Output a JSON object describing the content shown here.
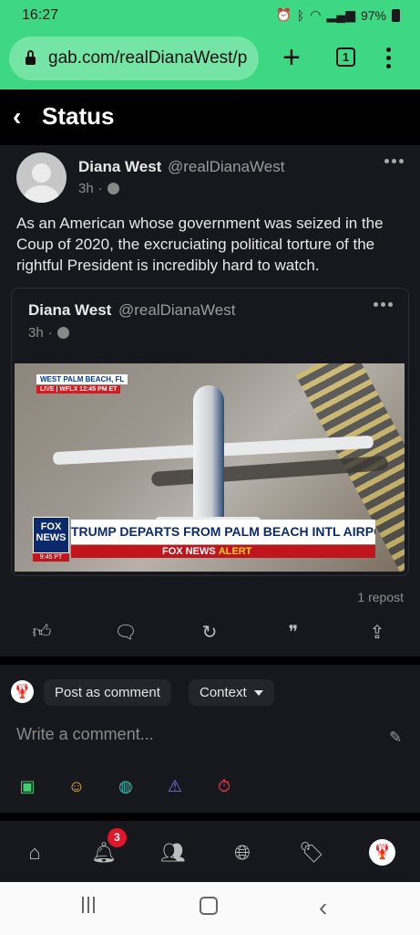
{
  "status_bar": {
    "time": "16:27",
    "battery": "97%"
  },
  "browser": {
    "url": "gab.com/realDianaWest/p",
    "tab_count": "1"
  },
  "header": {
    "back_icon": "‹",
    "title": "Status"
  },
  "post": {
    "author_name": "Diana West",
    "author_handle": "@realDianaWest",
    "age": "3h",
    "separator": "·",
    "text": "As an American whose government was seized in the Coup of 2020, the excruciating political torture of the rightful President is incredibly hard to watch.",
    "quote": {
      "author_name": "Diana West",
      "author_handle": "@realDianaWest",
      "age": "3h",
      "separator": "·",
      "media": {
        "location_tag": "WEST PALM BEACH, FL",
        "live_tag": "LIVE | WFLX 12:45 PM ET",
        "channel_logo": "FOX NEWS",
        "clock": "9:45 PT",
        "headline": "TRUMP DEPARTS FROM PALM BEACH INTL AIRPORT",
        "alert_brand": "FOX NEWS",
        "alert_word": "ALERT"
      }
    },
    "repost_count": "1 repost"
  },
  "composer": {
    "post_as_comment": "Post as comment",
    "context": "Context",
    "placeholder": "Write a comment..."
  },
  "bottom_nav": {
    "notifications_badge": "3"
  },
  "colors": {
    "chrome_green": "#3ed884",
    "surface": "#16181d",
    "badge_red": "#e0162b"
  }
}
